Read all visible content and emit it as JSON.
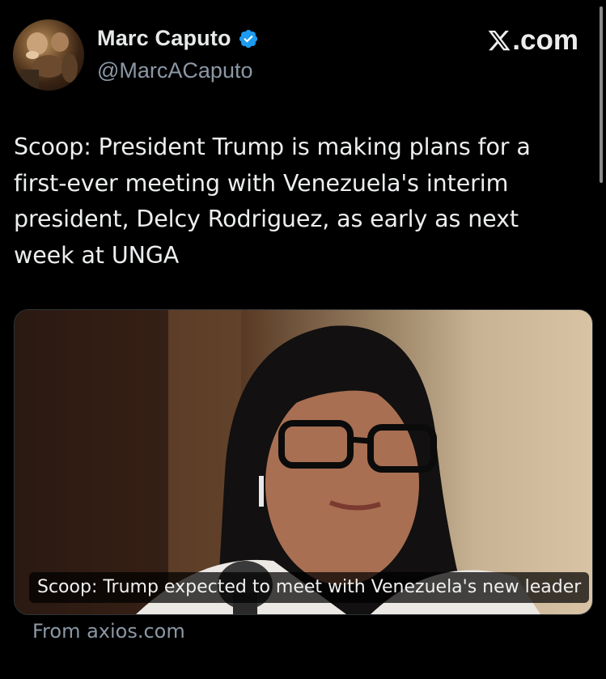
{
  "author": {
    "display_name": "Marc Caputo",
    "handle": "@MarcACaputo",
    "verified": true,
    "avatar_icon": "avatar-painting"
  },
  "brand": {
    "label": ".com",
    "icon": "x-logo-icon"
  },
  "tweet": {
    "text": "Scoop: President Trump is making plans for a first-ever meeting with Venezuela's interim president, Delcy Rodriguez, as early as next week at UNGA"
  },
  "link_card": {
    "caption": "Scoop: Trump expected to meet with Venezuela's new leader",
    "source": "From axios.com"
  },
  "colors": {
    "background": "#000000",
    "text_primary": "#e7e9ea",
    "text_secondary": "#8b98a5",
    "verified_blue": "#1d9bf0"
  }
}
